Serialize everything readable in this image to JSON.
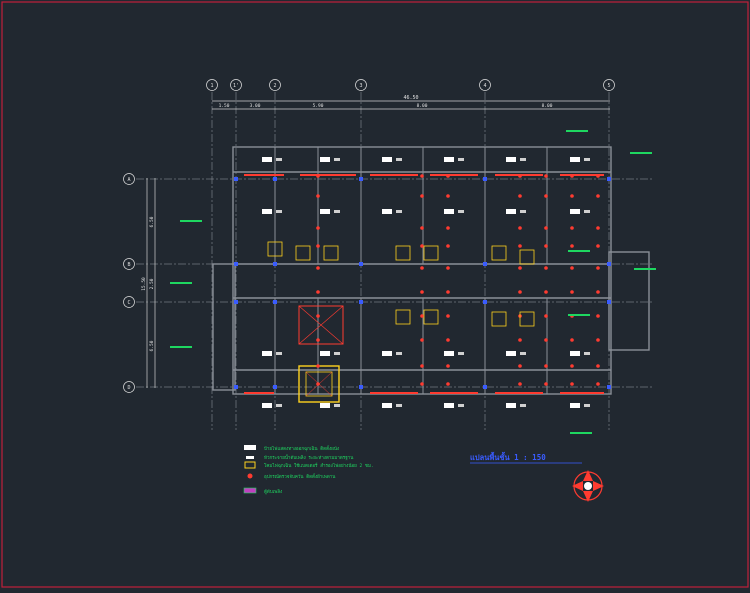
{
  "grid": {
    "columns": [
      "1",
      "1'",
      "2",
      "3",
      "4",
      "5"
    ],
    "rows": [
      "A",
      "B",
      "C",
      "D"
    ]
  },
  "dimensions": {
    "overall": "46.50",
    "segments": [
      "1.50",
      "3.00",
      "5.90",
      "8.00",
      "8.00"
    ],
    "rows": [
      "6.50",
      "2.50",
      "6.50"
    ],
    "overall_vertical": "15.50"
  },
  "legend": {
    "items": [
      {
        "symbol": "sign-panel",
        "text": "ป้ายไฟแสดงทางออกฉุกเฉิน ติดตั้งผนัง"
      },
      {
        "symbol": "sprinkler",
        "text": "หัวกระจายน้ำดับเพลิง ระยะห่างตามมาตรฐาน"
      },
      {
        "symbol": "emergency-light",
        "text": "โคมไฟฉุกเฉิน ใช้แบตเตอรี่ สำรองไฟอย่างน้อย 2 ชม."
      },
      {
        "symbol": "smoke-detector",
        "text": "อุปกรณ์ตรวจจับควัน ติดตั้งฝ้าเพดาน"
      },
      {
        "symbol": "extinguisher",
        "text": "ตู้ดับเพลิง"
      }
    ]
  },
  "plan_title": "แปลนพื้นชั้น 1 : 150",
  "colors": {
    "background": "#212830",
    "frame": "#c0203a",
    "wall": "#8a8f98",
    "axis": "#e8e8e8",
    "device": "#ff3b30",
    "label": "#1ed760",
    "column": "#3a5cff",
    "highlight": "#ffd21e"
  }
}
